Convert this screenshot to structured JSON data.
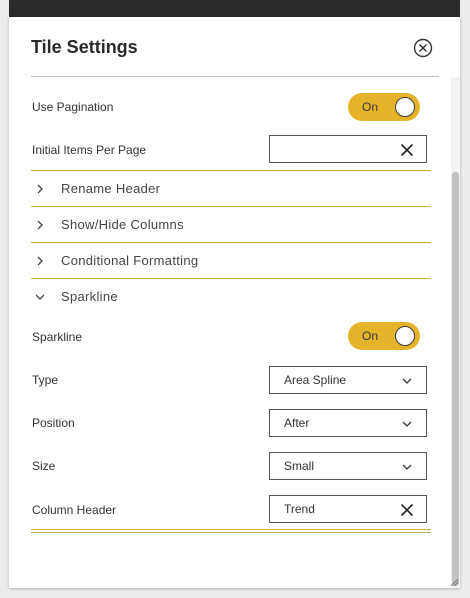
{
  "dialog": {
    "title": "Tile Settings",
    "close_icon": "circle-x-icon"
  },
  "pagination": {
    "label": "Use Pagination",
    "toggle": "On"
  },
  "items_per_page": {
    "label": "Initial Items Per Page",
    "value": "",
    "clear_icon": "x-icon"
  },
  "sections": [
    {
      "label": "Rename Header",
      "expanded": false,
      "icon": "chevron-right-icon"
    },
    {
      "label": "Show/Hide Columns",
      "expanded": false,
      "icon": "chevron-right-icon"
    },
    {
      "label": "Conditional Formatting",
      "expanded": false,
      "icon": "chevron-right-icon"
    },
    {
      "label": "Sparkline",
      "expanded": true,
      "icon": "chevron-down-icon"
    }
  ],
  "sparkline": {
    "toggle_label": "Sparkline",
    "toggle": "On",
    "type": {
      "label": "Type",
      "value": "Area Spline"
    },
    "position": {
      "label": "Position",
      "value": "After"
    },
    "size": {
      "label": "Size",
      "value": "Small"
    },
    "column_header": {
      "label": "Column Header",
      "value": "Trend"
    }
  },
  "colors": {
    "accent": "#e5b22a",
    "divider_gold": "#d4a92b",
    "topbar": "#2b2b2b"
  }
}
